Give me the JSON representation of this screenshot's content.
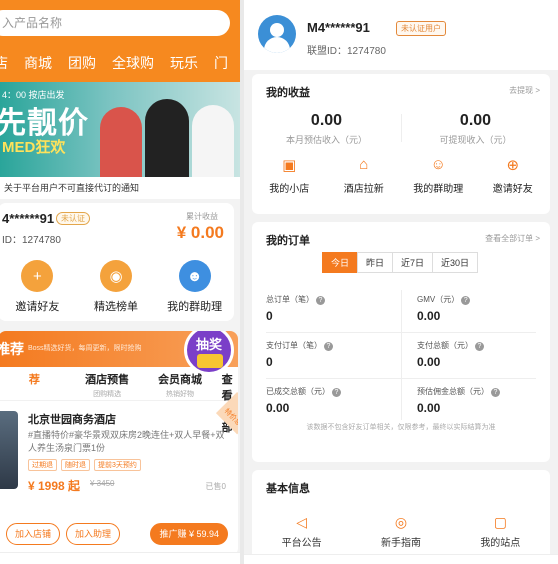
{
  "left": {
    "search_placeholder": "入产品名称",
    "nav": [
      "店",
      "商城",
      "团购",
      "全球购",
      "玩乐",
      "门"
    ],
    "banner": {
      "small": "4：00 按店出发",
      "big": "先靓价",
      "sub": "MED狂欢"
    },
    "notice": "关于平台用户不可直接代订的通知",
    "user": {
      "name": "4******91",
      "tag": "未认证",
      "id": "ID：1274780",
      "earn_label": "累计收益",
      "earn_value": "¥ 0.00"
    },
    "actions": [
      {
        "label": "邀请好友",
        "color": "#f4a23c",
        "icon": "+"
      },
      {
        "label": "精选榜单",
        "color": "#f4a23c",
        "icon": "◉"
      },
      {
        "label": "我的群助理",
        "color": "#3e8fe0",
        "icon": "☻"
      }
    ],
    "rec": {
      "title": "推荐",
      "slogan": "Boss精选好货，每周更新，限时抢购",
      "lottery": "抽奖",
      "tabs": [
        {
          "a": "荐",
          "b": ""
        },
        {
          "a": "酒店预售",
          "b": "团购精选"
        },
        {
          "a": "会员商城",
          "b": "热销好物"
        },
        {
          "a": "查看全部",
          "b": ""
        }
      ],
      "hotel": {
        "name": "北京世园商务酒店",
        "desc": "#直播特价#豪华景观双床房2晚连住+双人早餐+双人养生汤泉门票1份",
        "tags": [
          "过期退",
          "随时退",
          "提前3天预约"
        ],
        "price": "¥ 1998 起",
        "old": "¥ 3450",
        "sold": "已售0",
        "ribbon": "特价惠"
      },
      "buttons": [
        "加入店铺",
        "加入助理",
        "推广赚 ¥ 59.94"
      ]
    }
  },
  "right": {
    "profile": {
      "name": "M4******91",
      "id": "联盟ID：1274780",
      "verify": "未认证用户"
    },
    "income": {
      "title": "我的收益",
      "link": "去提现 >",
      "items": [
        {
          "value": "0.00",
          "label": "本月预估收入（元）"
        },
        {
          "value": "0.00",
          "label": "可提现收入（元）"
        }
      ],
      "icons": [
        {
          "label": "我的小店",
          "icon": "▣"
        },
        {
          "label": "酒店拉新",
          "icon": "⌂"
        },
        {
          "label": "我的群助理",
          "icon": "☺"
        },
        {
          "label": "邀请好友",
          "icon": "⊕"
        }
      ]
    },
    "orders": {
      "title": "我的订单",
      "link": "查看全部订单 >",
      "periods": [
        "今日",
        "昨日",
        "近7日",
        "近30日"
      ],
      "active_period": "今日",
      "stats": [
        {
          "label": "总订单（笔）",
          "value": "0"
        },
        {
          "label": "GMV（元）",
          "value": "0.00"
        },
        {
          "label": "支付订单（笔）",
          "value": "0"
        },
        {
          "label": "支付总额（元）",
          "value": "0.00"
        },
        {
          "label": "已成交总额（元）",
          "value": "0.00"
        },
        {
          "label": "预估佣金总额（元）",
          "value": "0.00"
        }
      ],
      "note": "该数据不包含好友订单相关，仅限参考，最终以实际结算为准"
    },
    "basic": {
      "title": "基本信息",
      "items": [
        {
          "label": "平台公告",
          "icon": "◁"
        },
        {
          "label": "新手指南",
          "icon": "◎"
        },
        {
          "label": "我的站点",
          "icon": "▢"
        }
      ]
    }
  }
}
